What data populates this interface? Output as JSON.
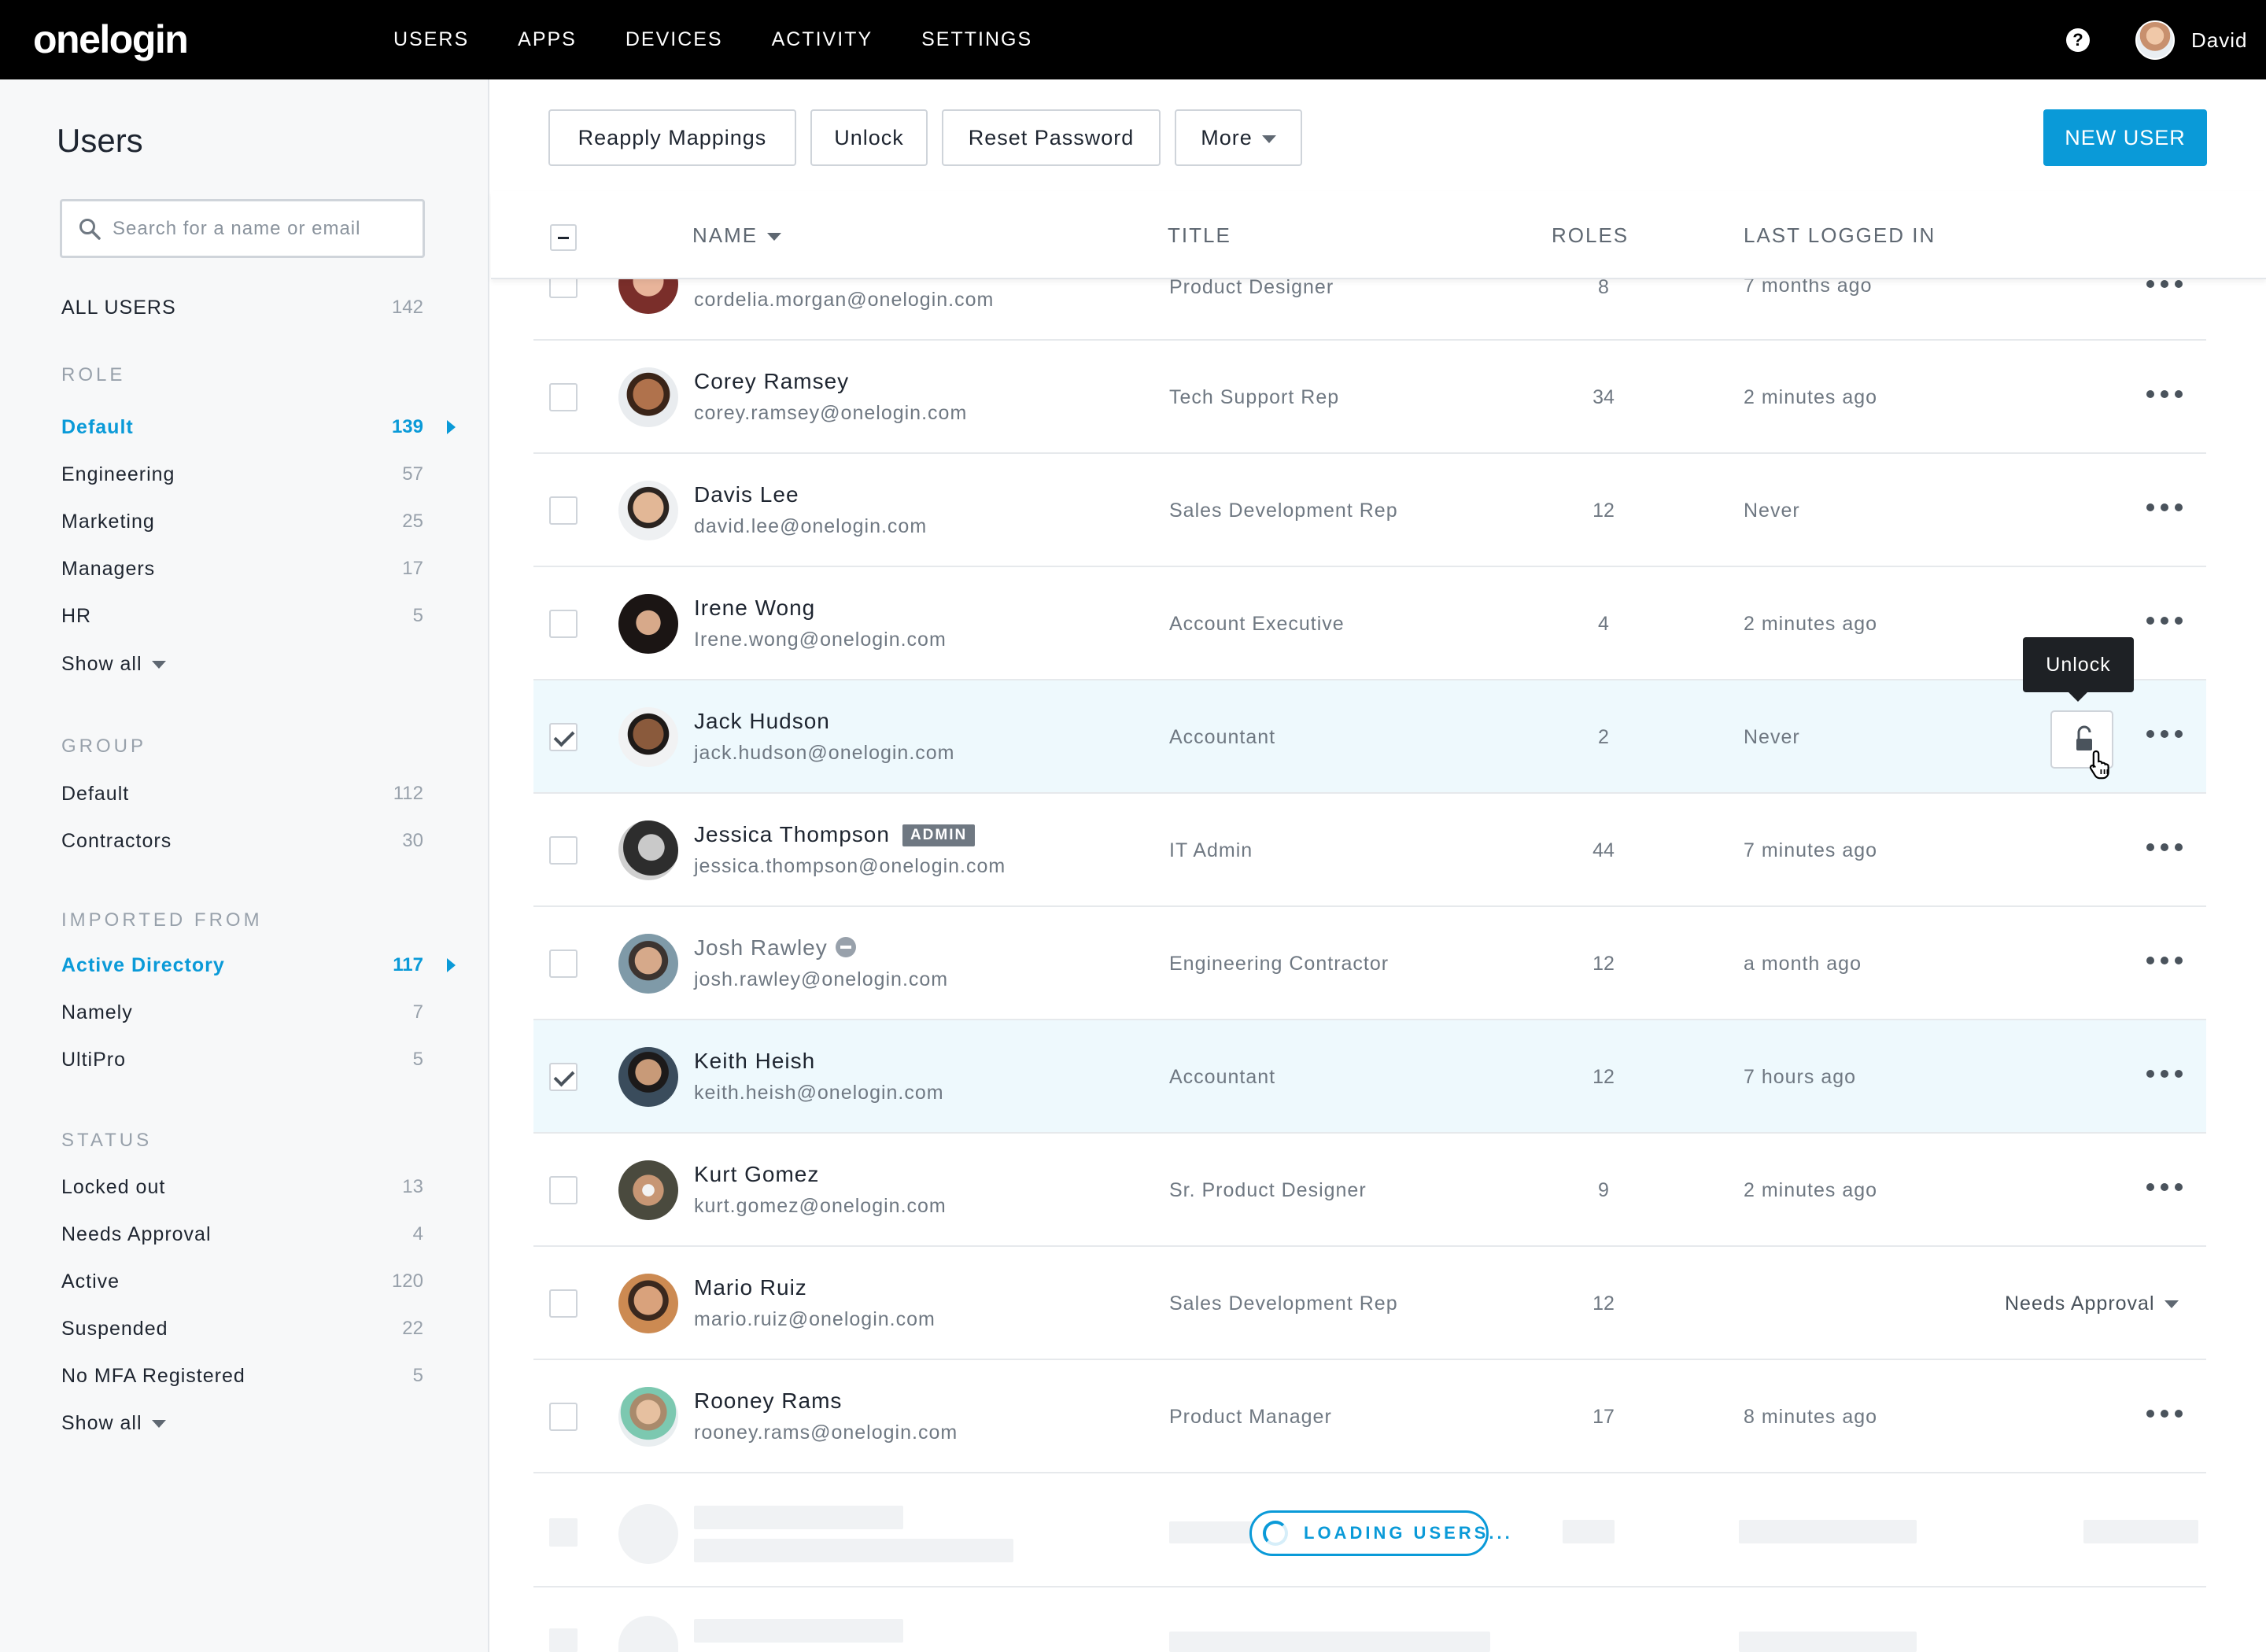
{
  "topbar": {
    "logo": "onelogin",
    "nav": [
      "USERS",
      "APPS",
      "DEVICES",
      "ACTIVITY",
      "SETTINGS"
    ],
    "user_name": "David"
  },
  "sidebar": {
    "title": "Users",
    "search_placeholder": "Search for a name or email",
    "all_users": {
      "label": "ALL USERS",
      "count": "142"
    },
    "role_heading": "ROLE",
    "roles": [
      {
        "label": "Default",
        "count": "139"
      },
      {
        "label": "Engineering",
        "count": "57"
      },
      {
        "label": "Marketing",
        "count": "25"
      },
      {
        "label": "Managers",
        "count": "17"
      },
      {
        "label": "HR",
        "count": "5"
      }
    ],
    "show_all": "Show all",
    "group_heading": "GROUP",
    "groups": [
      {
        "label": "Default",
        "count": "112"
      },
      {
        "label": "Contractors",
        "count": "30"
      }
    ],
    "imported_heading": "IMPORTED FROM",
    "imported": [
      {
        "label": "Active Directory",
        "count": "117"
      },
      {
        "label": "Namely",
        "count": "7"
      },
      {
        "label": "UltiPro",
        "count": "5"
      }
    ],
    "status_heading": "STATUS",
    "statuses": [
      {
        "label": "Locked out",
        "count": "13"
      },
      {
        "label": "Needs Approval",
        "count": "4"
      },
      {
        "label": "Active",
        "count": "120"
      },
      {
        "label": "Suspended",
        "count": "22"
      },
      {
        "label": "No MFA Registered",
        "count": "5"
      }
    ]
  },
  "toolbar": {
    "reapply": "Reapply Mappings",
    "unlock": "Unlock",
    "reset": "Reset Password",
    "more": "More",
    "new_user": "NEW USER"
  },
  "table": {
    "headers": {
      "name": "NAME",
      "title": "TITLE",
      "roles": "ROLES",
      "last": "LAST LOGGED IN"
    },
    "rows": [
      {
        "name": "",
        "email": "cordelia.morgan@onelogin.com",
        "title": "Product Designer",
        "roles": "8",
        "last": "7 months ago"
      },
      {
        "name": "Corey Ramsey",
        "email": "corey.ramsey@onelogin.com",
        "title": "Tech Support Rep",
        "roles": "34",
        "last": "2 minutes ago"
      },
      {
        "name": "Davis Lee",
        "email": "david.lee@onelogin.com",
        "title": "Sales Development Rep",
        "roles": "12",
        "last": "Never"
      },
      {
        "name": "Irene Wong",
        "email": "Irene.wong@onelogin.com",
        "title": "Account Executive",
        "roles": "4",
        "last": "2 minutes ago"
      },
      {
        "name": "Jack Hudson",
        "email": "jack.hudson@onelogin.com",
        "title": "Accountant",
        "roles": "2",
        "last": "Never"
      },
      {
        "name": "Jessica Thompson",
        "email": "jessica.thompson@onelogin.com",
        "title": "IT Admin",
        "roles": "44",
        "last": "7 minutes ago",
        "badge": "ADMIN"
      },
      {
        "name": "Josh Rawley",
        "email": "josh.rawley@onelogin.com",
        "title": "Engineering Contractor",
        "roles": "12",
        "last": "a month ago"
      },
      {
        "name": "Keith Heish",
        "email": "keith.heish@onelogin.com",
        "title": "Accountant",
        "roles": "12",
        "last": "7 hours ago"
      },
      {
        "name": "Kurt Gomez",
        "email": "kurt.gomez@onelogin.com",
        "title": "Sr. Product Designer",
        "roles": "9",
        "last": "2 minutes ago"
      },
      {
        "name": "Mario Ruiz",
        "email": "mario.ruiz@onelogin.com",
        "title": "Sales Development Rep",
        "roles": "12",
        "last": "",
        "status": "Needs Approval"
      },
      {
        "name": "Rooney Rams",
        "email": "rooney.rams@onelogin.com",
        "title": "Product Manager",
        "roles": "17",
        "last": "8 minutes ago"
      }
    ]
  },
  "tooltip": "Unlock",
  "loading": "LOADING USERS..."
}
